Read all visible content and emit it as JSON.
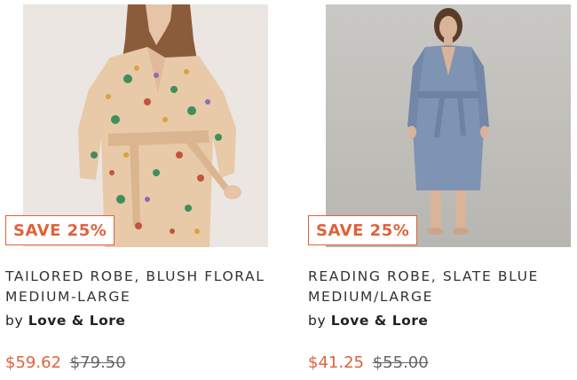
{
  "colors": {
    "accent": "#e0623a",
    "text": "#333333",
    "muted": "#666666"
  },
  "products": [
    {
      "image_alt": "Tailored Robe, Blush Floral",
      "badge": "SAVE 25%",
      "title_line1": "TAILORED ROBE, BLUSH FLORAL",
      "title_line2": "MEDIUM-LARGE",
      "by": "by",
      "brand": "Love & Lore",
      "sale_price": "$59.62",
      "original_price": "$79.50"
    },
    {
      "image_alt": "Reading Robe, Slate Blue",
      "badge": "SAVE 25%",
      "title_line1": "READING ROBE, SLATE BLUE",
      "title_line2": "MEDIUM/LARGE",
      "by": "by",
      "brand": "Love & Lore",
      "sale_price": "$41.25",
      "original_price": "$55.00"
    }
  ]
}
